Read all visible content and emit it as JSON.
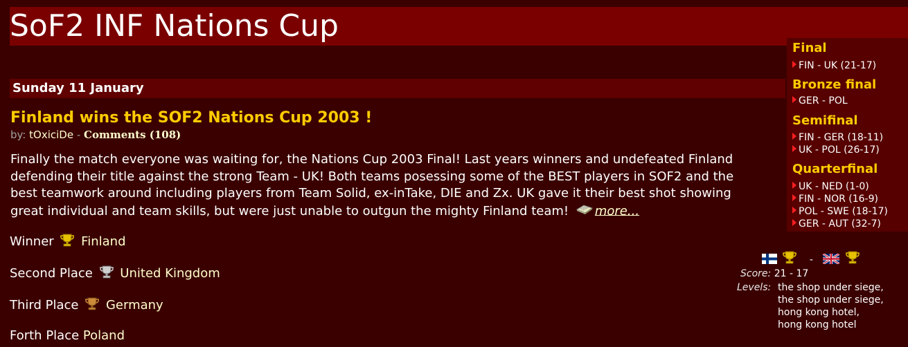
{
  "site": {
    "title": "SoF2 INF Nations Cup"
  },
  "news": {
    "date": "Sunday 11 January",
    "headline": "Finland wins the SOF2 Nations Cup 2003 !",
    "by_label": "by: ",
    "author": "tOxiciDe",
    "separator": " - ",
    "comments": "Comments (108)",
    "body_line1": "Finally the match everyone was waiting for, the Nations Cup 2003 Final! Last years winners and undefeated Finland",
    "body_line2": "defending their title against the strong Team - UK! Both teams posessing some of the BEST players in SOF2 and the",
    "body_line3": "best teamwork around including players from Team Solid, ex-inTake, DIE and Zx. UK gave it their best shot showing",
    "body_line4": "great individual and team skills, but were just unable to outgun the mighty Finland team!",
    "more_label": "more..."
  },
  "placings": [
    {
      "label": "Winner",
      "country": "Finland",
      "trophy": "gold-trophy-icon"
    },
    {
      "label": "Second Place",
      "country": "United Kingdom",
      "trophy": "silver-trophy-icon"
    },
    {
      "label": "Third Place",
      "country": "Germany",
      "trophy": "bronze-trophy-icon"
    },
    {
      "label": "Forth Place",
      "country": "Poland",
      "trophy": ""
    }
  ],
  "sidebar": {
    "final_heading": "Final",
    "final_items": [
      "FIN - UK (21-17)"
    ],
    "bronze_heading": "Bronze final",
    "bronze_items": [
      "GER - POL"
    ],
    "semi_heading": "Semifinal",
    "semi_items": [
      "FIN - GER (18-11)",
      "UK - POL (26-17)"
    ],
    "quarter_heading": "Quarterfinal",
    "quarter_items": [
      "UK - NED (1-0)",
      "FIN - NOR (16-9)",
      "POL - SWE (18-17)",
      "GER - AUT (32-7)"
    ]
  },
  "match": {
    "team1_flag": "finland-flag-icon",
    "team2_flag": "uk-flag-icon",
    "dash": "-",
    "score_label": "Score:",
    "score": "21 - 17",
    "levels_label": "Levels:",
    "levels": [
      "the shop under siege,",
      "the shop under siege,",
      "hong kong hotel,",
      "hong kong hotel"
    ]
  },
  "colors": {
    "background": "#3a0000",
    "title_bar": "#7a0000",
    "date_bar": "#600000",
    "sidebar": "#560000",
    "headline": "#ffcc00",
    "link": "#ffffcc",
    "arrow": "#ff2020"
  }
}
